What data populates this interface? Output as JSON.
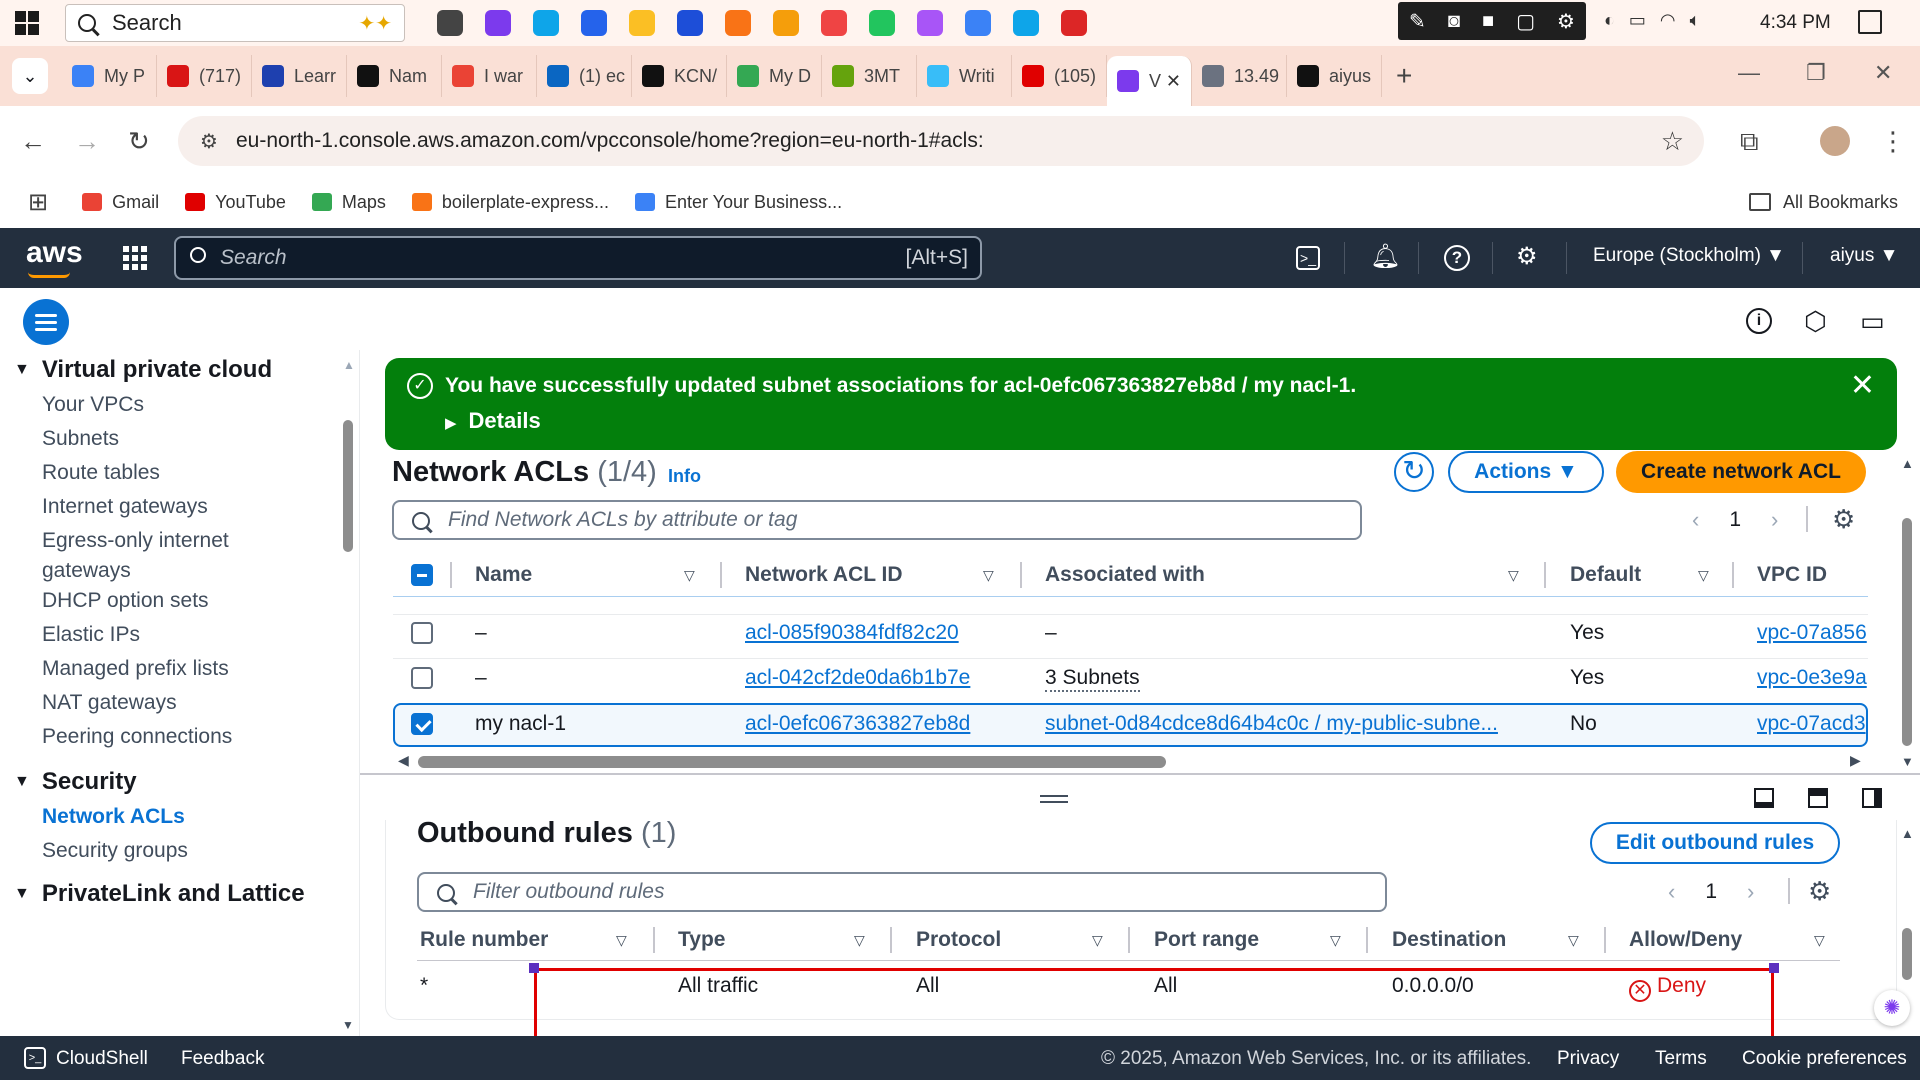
{
  "taskbar": {
    "search_label": "Search",
    "time": "4:34 PM",
    "icons": [
      "windows-icon",
      "task-view-icon",
      "copilot-icon",
      "edge-icon",
      "store-icon",
      "chrome-icon",
      "outlook-icon",
      "brave-icon",
      "files-icon",
      "wps-icon",
      "whatsapp-icon",
      "slack-icon",
      "git-icon",
      "vscode-icon",
      "recorder-icon"
    ]
  },
  "browser": {
    "tabs": [
      {
        "label": "My P",
        "color": "#3b82f6"
      },
      {
        "label": "(717)",
        "color": "#d91515"
      },
      {
        "label": "Learr",
        "color": "#1e40af"
      },
      {
        "label": "Nam",
        "color": "#111111"
      },
      {
        "label": "I war",
        "color": "#ea4335"
      },
      {
        "label": "(1) ec",
        "color": "#0a66c2"
      },
      {
        "label": "KCN/",
        "color": "#111111"
      },
      {
        "label": "My D",
        "color": "#34a853"
      },
      {
        "label": "3MT",
        "color": "#65a30d"
      },
      {
        "label": "Writi",
        "color": "#38bdf8"
      },
      {
        "label": "(105)",
        "color": "#e00000"
      },
      {
        "label": "V",
        "color": "#7c3aed"
      },
      {
        "label": "13.49",
        "color": "#6b7280"
      },
      {
        "label": "aiyus",
        "color": "#111111"
      }
    ],
    "active_tab_index": 11,
    "url": "eu-north-1.console.aws.amazon.com/vpcconsole/home?region=eu-north-1#acls:",
    "bookmarks": [
      {
        "label": "Gmail",
        "color": "#ea4335"
      },
      {
        "label": "YouTube",
        "color": "#e00000"
      },
      {
        "label": "Maps",
        "color": "#34a853"
      },
      {
        "label": "boilerplate-express...",
        "color": "#f97316"
      },
      {
        "label": "Enter Your Business...",
        "color": "#3b82f6"
      }
    ],
    "all_bookmarks": "All Bookmarks"
  },
  "aws_header": {
    "logo": "aws",
    "search_placeholder": "Search",
    "search_shortcut": "[Alt+S]",
    "region": "Europe (Stockholm) ▼",
    "user": "aiyus ▼"
  },
  "sidebar": {
    "sections": [
      {
        "title": "Virtual private cloud",
        "items": [
          "Your VPCs",
          "Subnets",
          "Route tables",
          "Internet gateways",
          "Egress-only internet gateways",
          "DHCP option sets",
          "Elastic IPs",
          "Managed prefix lists",
          "NAT gateways",
          "Peering connections"
        ]
      },
      {
        "title": "Security",
        "items": [
          "Network ACLs",
          "Security groups"
        ]
      },
      {
        "title": "PrivateLink and Lattice",
        "items": []
      }
    ],
    "active_item": "Network ACLs"
  },
  "flash": {
    "message": "You have successfully updated subnet associations for acl-0efc067363827eb8d / my nacl-1.",
    "details": "Details",
    "color": "#037f0c"
  },
  "acl": {
    "title": "Network ACLs",
    "count": "(1/4)",
    "info": "Info",
    "actions": "Actions ▼",
    "create": "Create network ACL",
    "filter_placeholder": "Find Network ACLs by attribute or tag",
    "page": "1",
    "columns": [
      "Name",
      "Network ACL ID",
      "Associated with",
      "Default",
      "VPC ID"
    ],
    "rows": [
      {
        "name": "–",
        "id": "acl-085f90384fdf82c20",
        "assoc": "–",
        "default": "Yes",
        "vpc": "vpc-07a856",
        "selected": false
      },
      {
        "name": "–",
        "id": "acl-042cf2de0da6b1b7e",
        "assoc": "3 Subnets",
        "default": "Yes",
        "vpc": "vpc-0e3e9a",
        "selected": false
      },
      {
        "name": "my nacl-1",
        "id": "acl-0efc067363827eb8d",
        "assoc": "subnet-0d84cdce8d64b4c0c / my-public-subne...",
        "default": "No",
        "vpc": "vpc-07acd3",
        "selected": true
      }
    ]
  },
  "outbound": {
    "title": "Outbound rules",
    "count": "(1)",
    "edit": "Edit outbound rules",
    "filter_placeholder": "Filter outbound rules",
    "page": "1",
    "columns": [
      "Rule number",
      "Type",
      "Protocol",
      "Port range",
      "Destination",
      "Allow/Deny"
    ],
    "rows": [
      {
        "rule": "*",
        "type": "All traffic",
        "protocol": "All",
        "port": "All",
        "dest": "0.0.0.0/0",
        "action": "Deny"
      }
    ]
  },
  "footer": {
    "cloudshell": "CloudShell",
    "feedback": "Feedback",
    "copyright": "© 2025, Amazon Web Services, Inc. or its affiliates.",
    "privacy": "Privacy",
    "terms": "Terms",
    "cookies": "Cookie preferences"
  }
}
